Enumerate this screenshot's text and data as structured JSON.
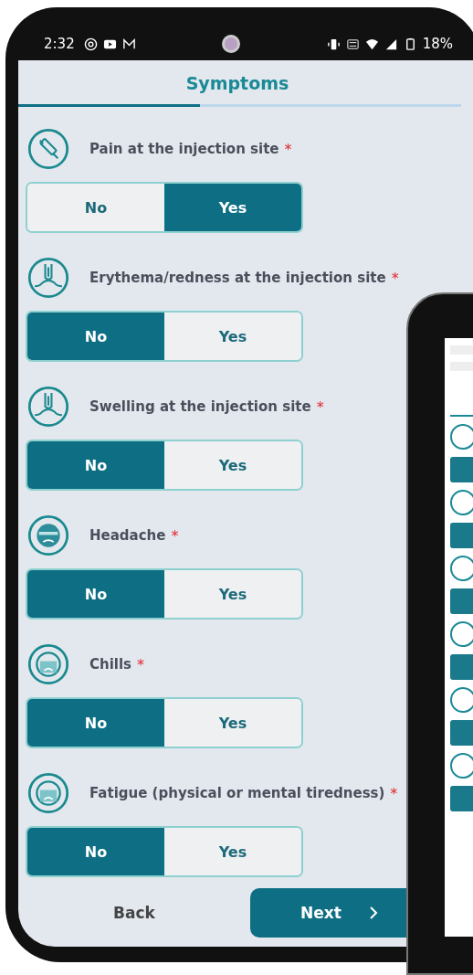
{
  "status_bar": {
    "time": "2:32",
    "battery": "18%"
  },
  "header": {
    "title": "Symptoms",
    "progress": {
      "level": 0.41
    }
  },
  "questions": [
    {
      "kind": "syringe",
      "label": "Pain at the injection site",
      "mark": "*",
      "options": [
        {
          "label": "No",
          "selected": false
        },
        {
          "label": "Yes",
          "selected": true
        }
      ]
    },
    {
      "kind": "skin",
      "label": "Erythema/redness at the injection site",
      "mark": "*",
      "options": [
        {
          "label": "No",
          "selected": true
        },
        {
          "label": "Yes",
          "selected": false
        }
      ]
    },
    {
      "kind": "skin",
      "label": "Swelling at the injection site",
      "mark": "*",
      "options": [
        {
          "label": "No",
          "selected": true
        },
        {
          "label": "Yes",
          "selected": false
        }
      ]
    },
    {
      "kind": "head",
      "label": "Headache",
      "mark": "*",
      "options": [
        {
          "label": "No",
          "selected": true
        },
        {
          "label": "Yes",
          "selected": false
        }
      ]
    },
    {
      "kind": "face",
      "label": "Chills",
      "mark": "*",
      "options": [
        {
          "label": "No",
          "selected": true
        },
        {
          "label": "Yes",
          "selected": false
        }
      ]
    },
    {
      "kind": "face",
      "label": "Fatigue (physical or mental tiredness)",
      "mark": "*",
      "options": [
        {
          "label": "No",
          "selected": true
        },
        {
          "label": "Yes",
          "selected": false
        }
      ]
    }
  ],
  "footer": {
    "back": "Back",
    "next": "Next"
  }
}
